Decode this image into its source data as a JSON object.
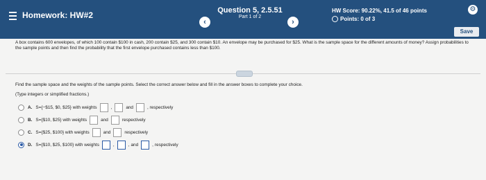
{
  "header": {
    "menu_icon": "hamburger-menu-icon",
    "homework_title": "Homework: HW#2",
    "question_title": "Question 5, 2.5.51",
    "question_part": "Part 1 of 2",
    "hw_score": "HW Score: 90.22%, 41.5 of 46 points",
    "points": "Points: 0 of 3",
    "prev_icon": "‹",
    "next_icon": "›",
    "settings_icon": "gear-icon",
    "save_label": "Save",
    "brand_color": "#24507e"
  },
  "problem": {
    "text": "A box contains 600 envelopes, of which 100 contain $100 in cash, 200 contain $25, and 300 contain $10. An envelope may be purchased for $25. What is the sample space for the different amounts of money? Assign probabilities to the sample points and then find the probability that the first envelope purchased contains less than $100."
  },
  "instruction": "Find the sample space and the weights of the sample points. Select the correct answer below and fill in the answer boxes to complete your choice.",
  "type_hint": "(Type integers or simplified fractions.)",
  "options": [
    {
      "letter": "A.",
      "set": "S={−$15, $0, $25} with weights",
      "and": "and",
      "tail": ", respectively",
      "selected": false
    },
    {
      "letter": "B.",
      "set": "S={$10, $25} with weights",
      "and": "and",
      "tail": "respectively",
      "selected": false
    },
    {
      "letter": "C.",
      "set": "S={$25, $100} with weights",
      "and": "and",
      "tail": "respectively",
      "selected": false
    },
    {
      "letter": "D.",
      "set": "S={$10, $25, $100} with weights",
      "and": "and",
      "tail": "respectively",
      "selected": true
    }
  ]
}
